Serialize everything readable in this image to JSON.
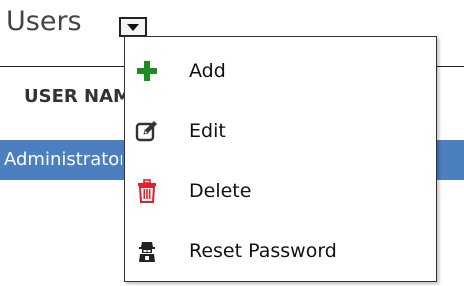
{
  "header": {
    "title": "Users",
    "dropdown_icon": "chevron-down-icon"
  },
  "table": {
    "columns": [
      "USER NAME"
    ],
    "rows": [
      {
        "user_name": "Administrator",
        "selected": true
      }
    ]
  },
  "context_menu": {
    "items": [
      {
        "label": "Add",
        "icon": "plus-icon",
        "color": "#1e8c1e"
      },
      {
        "label": "Edit",
        "icon": "edit-icon",
        "color": "#333333"
      },
      {
        "label": "Delete",
        "icon": "trash-icon",
        "color": "#e0202a"
      },
      {
        "label": "Reset Password",
        "icon": "user-lock-icon",
        "color": "#222222"
      }
    ]
  },
  "colors": {
    "selection": "#4c7fc0",
    "add": "#1e8c1e",
    "delete": "#e0202a"
  }
}
